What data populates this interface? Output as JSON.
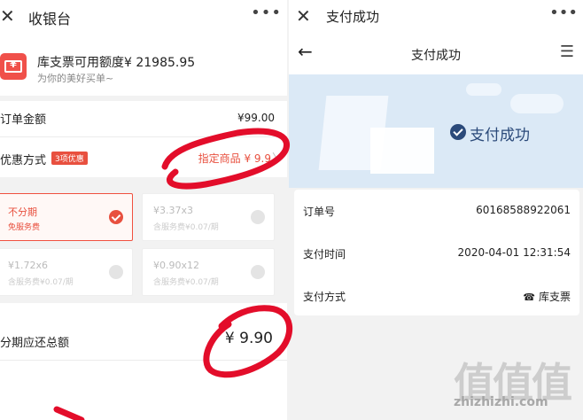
{
  "left": {
    "header": {
      "title": "收银台",
      "close_icon": "close-icon",
      "more_icon": "more-icon"
    },
    "coupon": {
      "main": "库支票可用额度¥ 21985.95",
      "sub": "为你的美好买单~",
      "icon": "ticket-icon",
      "color": "#f0504a"
    },
    "order": {
      "label": "订单金额",
      "value": "¥99.00"
    },
    "discount": {
      "label": "优惠方式",
      "badge": "3项优惠",
      "promo": "指定商品 ¥ 9.9"
    },
    "plans": [
      {
        "main": "不分期",
        "sub": "免服务费",
        "selected": true
      },
      {
        "main": "¥3.37x3",
        "sub": "含服务费¥0.07/期",
        "selected": false
      },
      {
        "main": "¥1.72x6",
        "sub": "含服务费¥0.07/期",
        "selected": false
      },
      {
        "main": "¥0.90x12",
        "sub": "含服务费¥0.07/期",
        "selected": false
      }
    ],
    "total": {
      "label": "分期应还总额",
      "value": "¥ 9.90"
    }
  },
  "right": {
    "header": {
      "title": "支付成功",
      "close_icon": "close-icon",
      "more_icon": "more-icon"
    },
    "nav": {
      "title": "支付成功",
      "back_icon": "arrow-left-icon",
      "menu_icon": "menu-icon"
    },
    "banner": {
      "status": "支付成功",
      "status_color": "#2b4a7a",
      "bg_color": "#dbe9f6"
    },
    "details": [
      {
        "label": "订单号",
        "value": "60168588922061"
      },
      {
        "label": "支付时间",
        "value": "2020-04-01 12:31:54"
      },
      {
        "label": "支付方式",
        "value": "库支票"
      }
    ]
  },
  "watermark": {
    "logo": "值值值",
    "text": "zhizhizhi.com"
  },
  "accent": "#e8503f"
}
